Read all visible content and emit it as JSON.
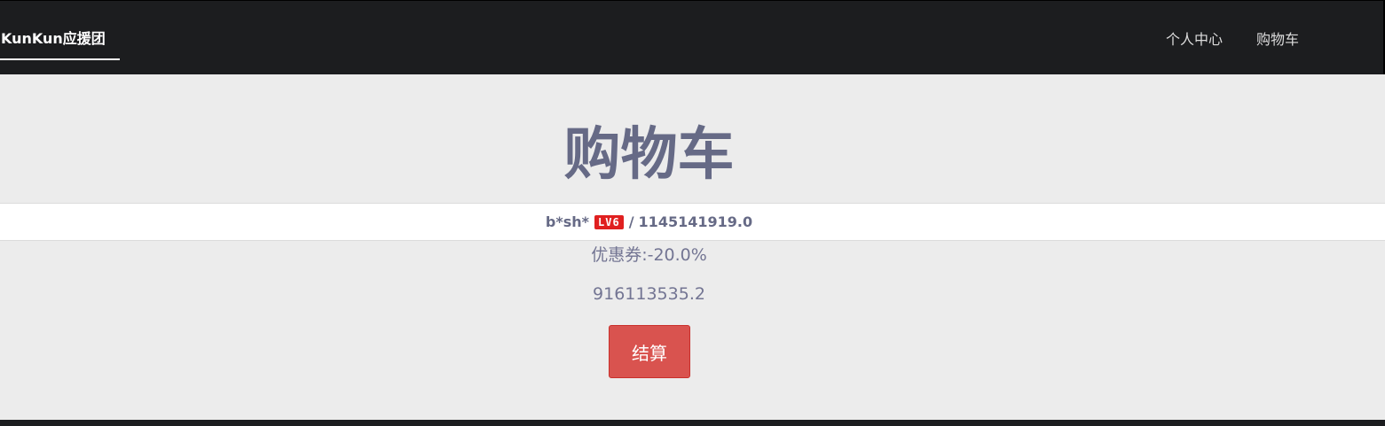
{
  "nav": {
    "brand": "KunKun应援团",
    "links": [
      "个人中心",
      "购物车"
    ]
  },
  "page": {
    "title": "购物车"
  },
  "user": {
    "name": "b*sh*",
    "level": "LV6",
    "separator": "/",
    "balance": "1145141919.0"
  },
  "cart": {
    "coupon": "优惠券:-20.0%",
    "total": "916113535.2",
    "checkout_label": "结算"
  },
  "colors": {
    "navbar": "#1c1d1f",
    "background": "#ececec",
    "title": "#666a86",
    "level_badge": "#e02020",
    "checkout_button": "#d9534f"
  }
}
